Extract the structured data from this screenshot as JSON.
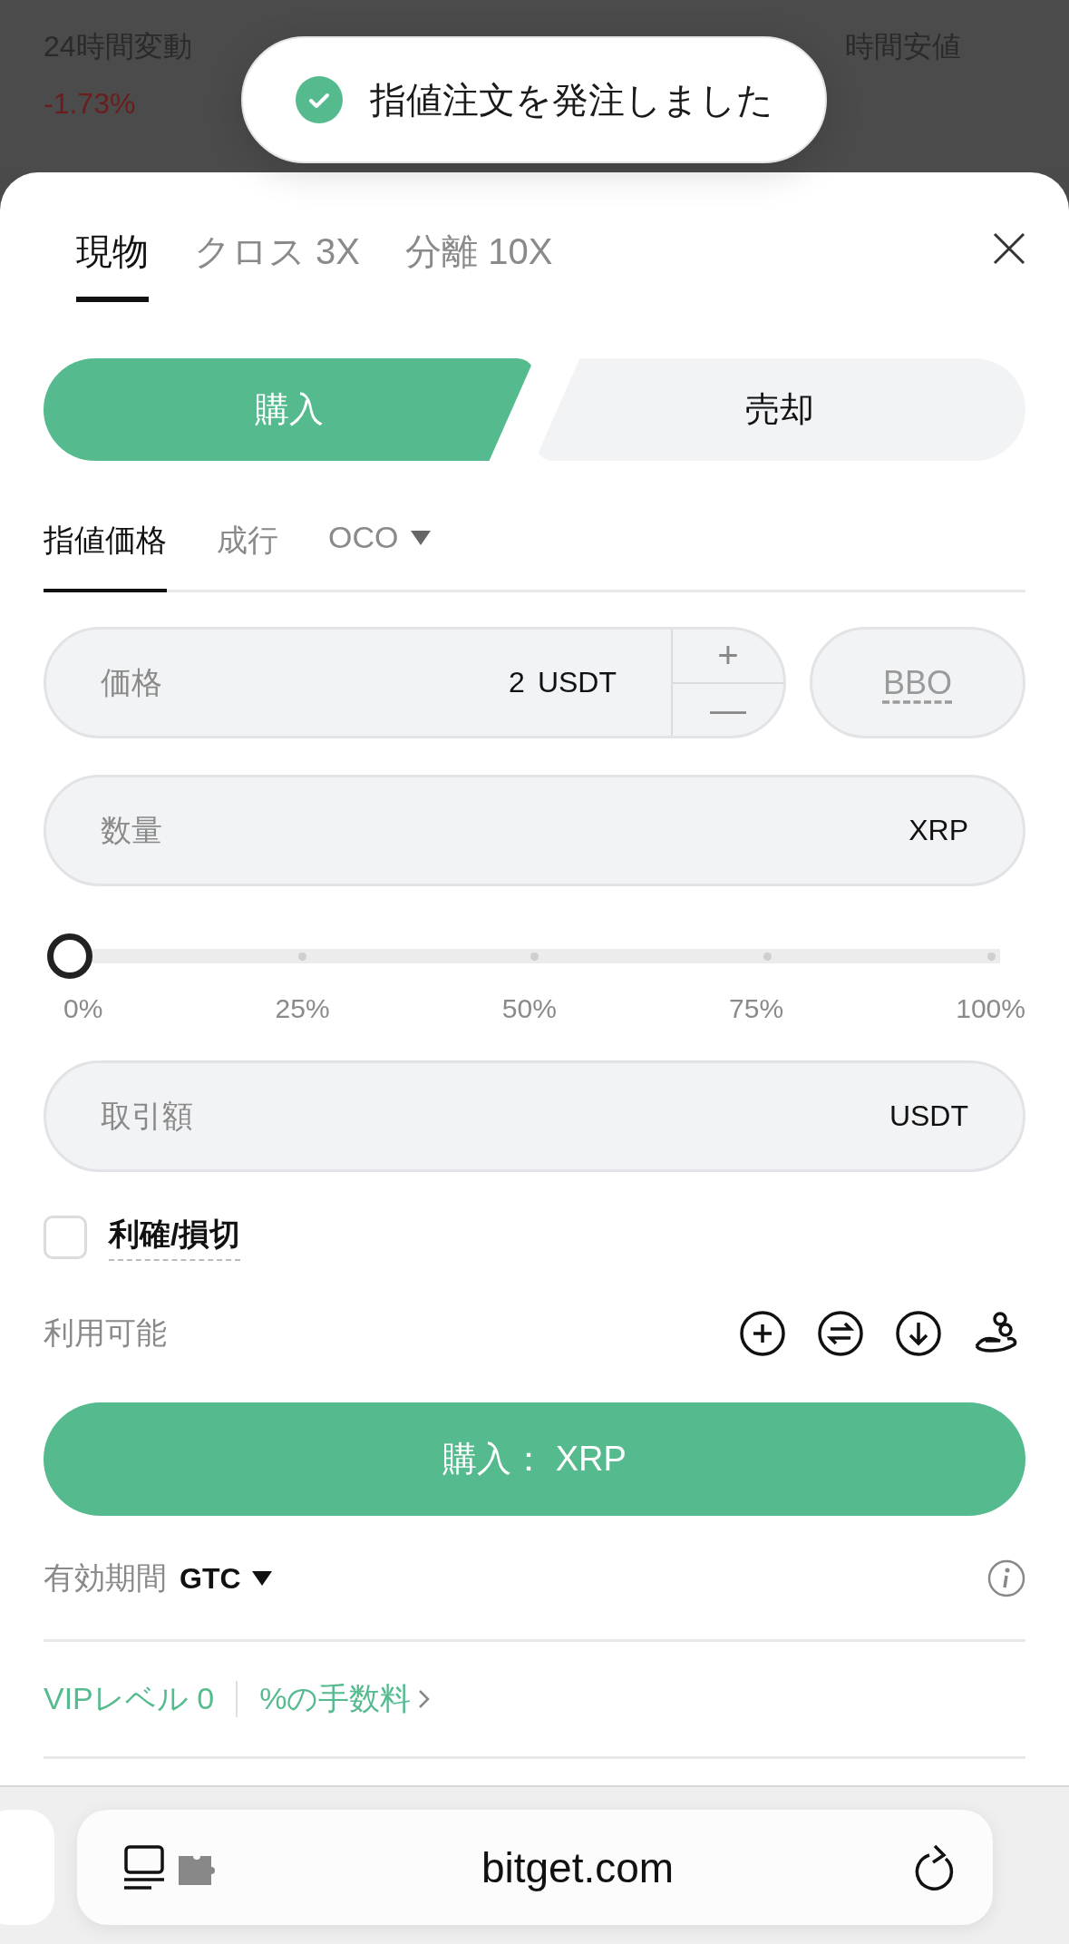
{
  "background": {
    "stats": [
      {
        "label": "24時間変動",
        "value": "-1.73%"
      },
      {
        "label": "時間安値"
      }
    ]
  },
  "toast": {
    "message": "指値注文を発注しました"
  },
  "account_tabs": [
    {
      "label": "現物",
      "selected": true
    },
    {
      "label": "クロス 3X",
      "selected": false
    },
    {
      "label": "分離 10X",
      "selected": false
    }
  ],
  "side_toggle": [
    {
      "label": "購入",
      "selected": true
    },
    {
      "label": "売却",
      "selected": false
    }
  ],
  "order_types": [
    {
      "label": "指値価格",
      "selected": true,
      "dropdown": false
    },
    {
      "label": "成行",
      "selected": false,
      "dropdown": false
    },
    {
      "label": "OCO",
      "selected": false,
      "dropdown": true
    }
  ],
  "price_field": {
    "placeholder": "価格",
    "value": "2",
    "unit": "USDT",
    "plus": "+",
    "minus": "—"
  },
  "bbo_button": "BBO",
  "quantity_field": {
    "placeholder": "数量",
    "unit": "XRP"
  },
  "slider": {
    "level": 0,
    "marks": [
      "0%",
      "25%",
      "50%",
      "75%",
      "100%"
    ]
  },
  "amount_field": {
    "placeholder": "取引額",
    "unit": "USDT"
  },
  "tp_sl": {
    "label": "利確/損切",
    "checked": false
  },
  "available": {
    "label": "利用可能"
  },
  "submit_button": "購入： XRP",
  "validity": {
    "label": "有効期間",
    "value": "GTC"
  },
  "vip": {
    "level": "VIPレベル 0",
    "fees": "%の手数料"
  },
  "browser": {
    "url": "bitget.com"
  }
}
